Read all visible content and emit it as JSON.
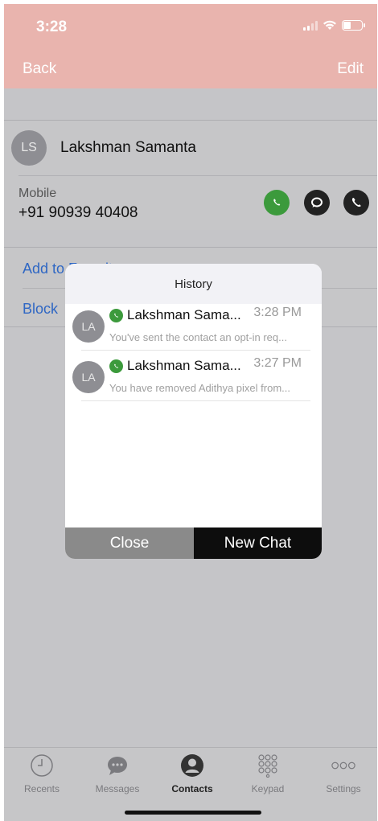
{
  "status": {
    "time": "3:28"
  },
  "nav": {
    "back": "Back",
    "edit": "Edit"
  },
  "contact": {
    "initials": "LS",
    "name": "Lakshman Samanta",
    "phone_label": "Mobile",
    "phone_number": "+91 90939 40408",
    "actions": [
      "whatsapp-icon",
      "message-icon",
      "phone-icon"
    ]
  },
  "options": {
    "add_favorite": "Add to Favorites",
    "block": "Block"
  },
  "modal": {
    "title": "History",
    "items": [
      {
        "initials": "LA",
        "name": "Lakshman Sama...",
        "time": "3:28 PM",
        "preview": "You've sent the contact an opt-in req..."
      },
      {
        "initials": "LA",
        "name": "Lakshman Sama...",
        "time": "3:27 PM",
        "preview": "You have removed Adithya pixel from..."
      }
    ],
    "close_label": "Close",
    "new_chat_label": "New Chat"
  },
  "tabs": [
    {
      "label": "Recents",
      "icon": "clock-icon",
      "active": false
    },
    {
      "label": "Messages",
      "icon": "chat-bubble-icon",
      "active": false
    },
    {
      "label": "Contacts",
      "icon": "person-icon",
      "active": true
    },
    {
      "label": "Keypad",
      "icon": "keypad-icon",
      "active": false
    },
    {
      "label": "Settings",
      "icon": "more-icon",
      "active": false
    }
  ],
  "colors": {
    "accent": "#e9b4ae",
    "link": "#2f67c4",
    "whatsapp": "#3c9a3c"
  }
}
